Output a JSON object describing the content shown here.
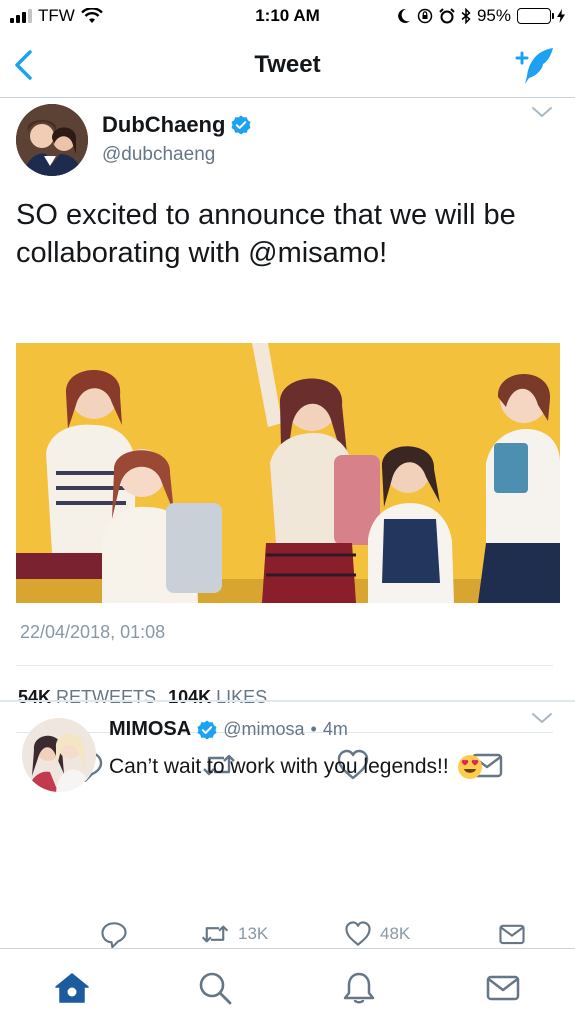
{
  "status_bar": {
    "carrier": "TFW",
    "time": "1:10 AM",
    "battery": "95%",
    "battery_level": 0.95
  },
  "navbar": {
    "title": "Tweet",
    "back_icon": "chevron-left-icon",
    "compose_icon": "compose-tweet-icon",
    "accent": "#1da1f2"
  },
  "tweet": {
    "author_name": "DubChaeng",
    "author_handle": "@dubchaeng",
    "text": "SO excited to announce that we will be collaborating with @misamo!",
    "timestamp": "22/04/2018, 01:08",
    "retweets_count": "54K",
    "retweets_label": "RETWEETS",
    "likes_count": "104K",
    "likes_label": "LIKES",
    "media_description_icon": "photo"
  },
  "reply": {
    "author_name": "MIMOSA",
    "author_handle": "@mimosa",
    "separator": "•",
    "time": "4m",
    "text": "Can’t wait to work with you legends!!",
    "emoji": "heart-eyes-emoji",
    "retweets": "13K",
    "likes": "48K"
  },
  "tabbar": {
    "items": [
      "home-icon",
      "search-icon",
      "notifications-icon",
      "messages-icon"
    ],
    "active": "home-icon"
  },
  "colors": {
    "accent": "#1da1f2",
    "text_primary": "#14171a",
    "text_secondary": "#657786",
    "home_active": "#1b5b9e"
  }
}
